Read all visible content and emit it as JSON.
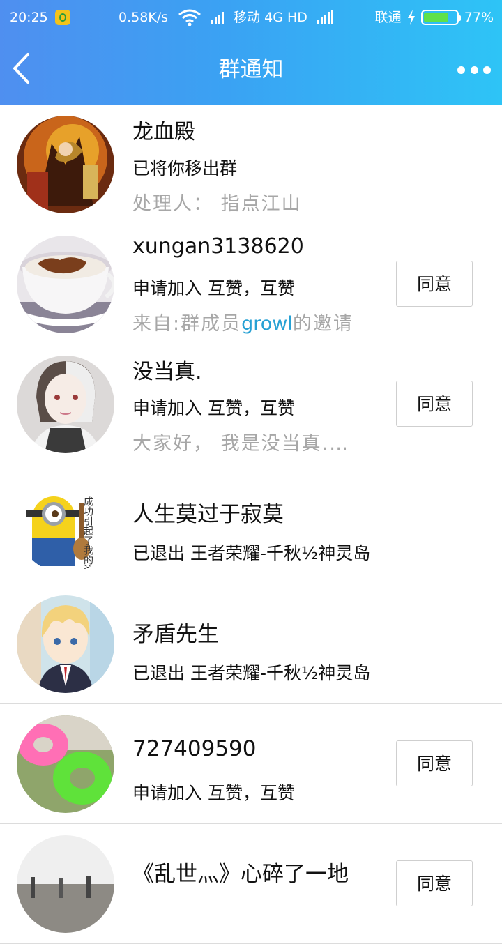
{
  "status_bar": {
    "time": "20:25",
    "net_speed": "0.58K/s",
    "carrier1": "移动 4G HD",
    "carrier2": "联通",
    "battery": "77%",
    "battery_level": 0.77,
    "app_icon": "qq-music-icon"
  },
  "header": {
    "title": "群通知",
    "back_icon": "back-arrow-icon",
    "more_icon": "more-dots-icon"
  },
  "notifications": [
    {
      "name": "龙血殿",
      "line2": "已将你移出群",
      "line3": "处理人：  指点江山",
      "avatar": "avatar-dragon"
    },
    {
      "name": "xungan3138620",
      "line2": "申请加入 互赞，互赞",
      "line3_pre": "来自:群成员",
      "line3_hl": "growl",
      "line3_post": "的邀请",
      "button": "同意",
      "avatar": "avatar-coffee"
    },
    {
      "name": "没当真.",
      "line2": "申请加入 互赞，互赞",
      "line3": "大家好，  我是没当真.…",
      "button": "同意",
      "avatar": "avatar-girl"
    },
    {
      "name": "人生莫过于寂莫",
      "line2": "已退出 王者荣耀-千秋½神灵岛",
      "avatar": "avatar-minion"
    },
    {
      "name": "矛盾先生",
      "line2": "已退出 王者荣耀-千秋½神灵岛",
      "avatar": "avatar-anime-boy"
    },
    {
      "name": "727409590",
      "line2": "申请加入 互赞，互赞",
      "button": "同意",
      "avatar": "avatar-swim-rings"
    },
    {
      "name": "《乱世灬》心碎了一地",
      "button": "同意",
      "avatar": "avatar-street"
    }
  ]
}
